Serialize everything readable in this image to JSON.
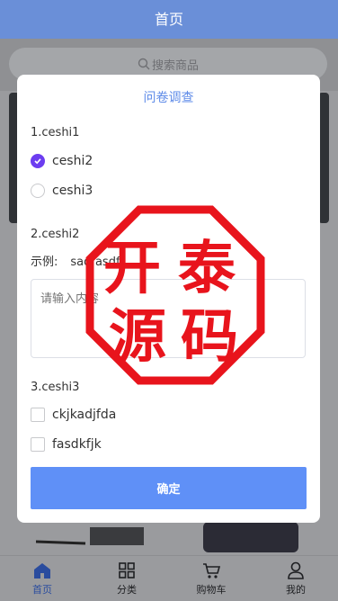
{
  "header": {
    "title": "首页"
  },
  "search": {
    "placeholder": "搜索商品"
  },
  "modal": {
    "title": "问卷调查",
    "q1": {
      "title": "1.ceshi1",
      "options": [
        "ceshi2",
        "ceshi3"
      ],
      "selected": "ceshi2"
    },
    "q2": {
      "title": "2.ceshi2",
      "example_label": "示例:",
      "example_value": "sadfasdf",
      "placeholder": "请输入内容"
    },
    "q3": {
      "title": "3.ceshi3",
      "options": [
        "ckjkadjfda",
        "fasdkfjk"
      ]
    },
    "confirm": "确定"
  },
  "seal": {
    "text": [
      "开",
      "泰",
      "源",
      "码"
    ],
    "color": "#e8141c"
  },
  "tabs": [
    {
      "label": "首页",
      "icon": "home-icon",
      "active": true
    },
    {
      "label": "分类",
      "icon": "grid-icon",
      "active": false
    },
    {
      "label": "购物车",
      "icon": "cart-icon",
      "active": false
    },
    {
      "label": "我的",
      "icon": "user-icon",
      "active": false
    }
  ],
  "colors": {
    "primary": "#5f90f7",
    "header": "#6a8fd8",
    "radio_checked": "#6c3df0"
  }
}
